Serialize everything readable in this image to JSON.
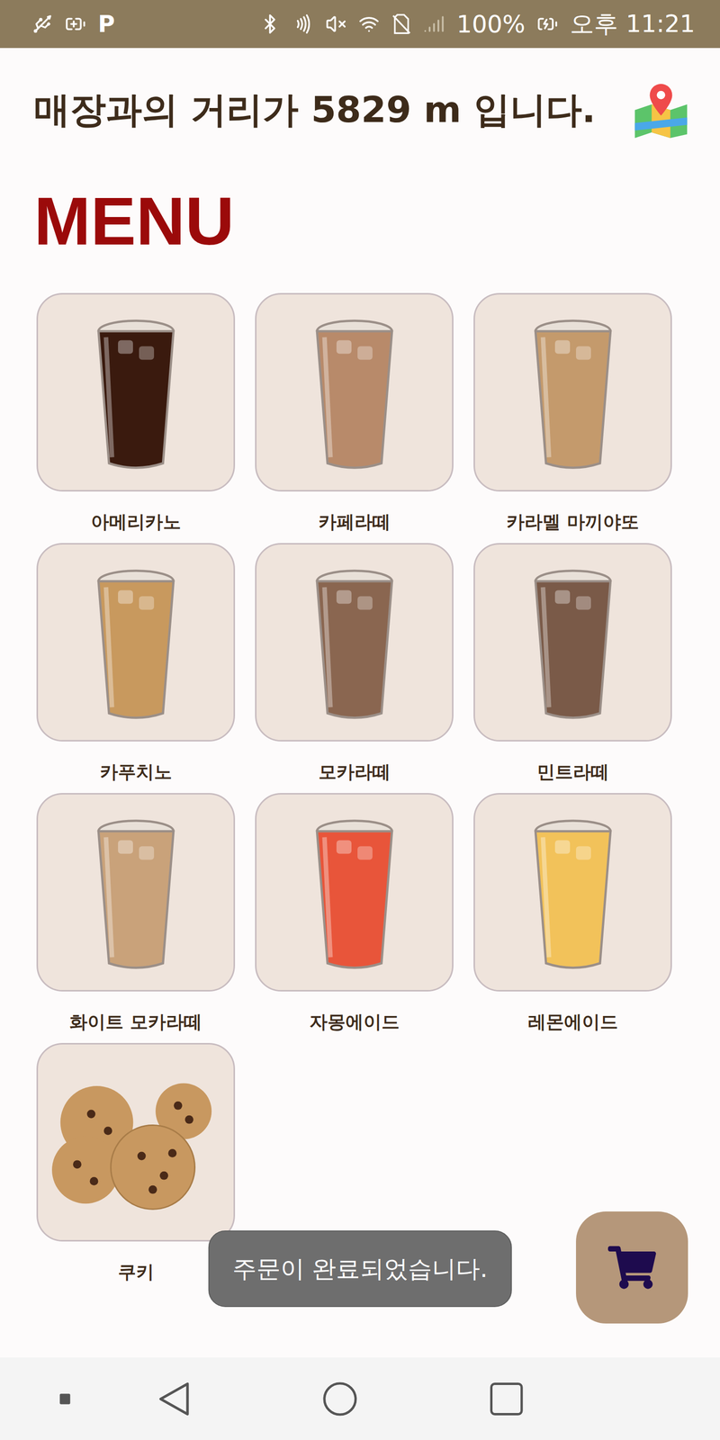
{
  "status_bar": {
    "left_badge": "P",
    "battery": "100%",
    "time": "오후 11:21"
  },
  "header": {
    "distance_text": "매장과의 거리가 5829 m 입니다."
  },
  "menu": {
    "title": "MENU",
    "items": [
      {
        "name": "아메리카노",
        "kind": "drink",
        "color": "#3a1a0e"
      },
      {
        "name": "카페라떼",
        "kind": "drink",
        "color": "#b88a6a"
      },
      {
        "name": "카라멜 마끼야또",
        "kind": "drink",
        "color": "#c49a6c"
      },
      {
        "name": "카푸치노",
        "kind": "drink",
        "color": "#c8995e"
      },
      {
        "name": "모카라떼",
        "kind": "drink",
        "color": "#8a6650"
      },
      {
        "name": "민트라떼",
        "kind": "drink",
        "color": "#7a5a48"
      },
      {
        "name": "화이트 모카라떼",
        "kind": "drink",
        "color": "#c9a27a"
      },
      {
        "name": "자몽에이드",
        "kind": "drink",
        "color": "#e8553a"
      },
      {
        "name": "레몬에이드",
        "kind": "drink",
        "color": "#f2c25a"
      },
      {
        "name": "쿠키",
        "kind": "cookie",
        "color": "#c89860"
      }
    ]
  },
  "toast": "주문이 완료되었습니다."
}
